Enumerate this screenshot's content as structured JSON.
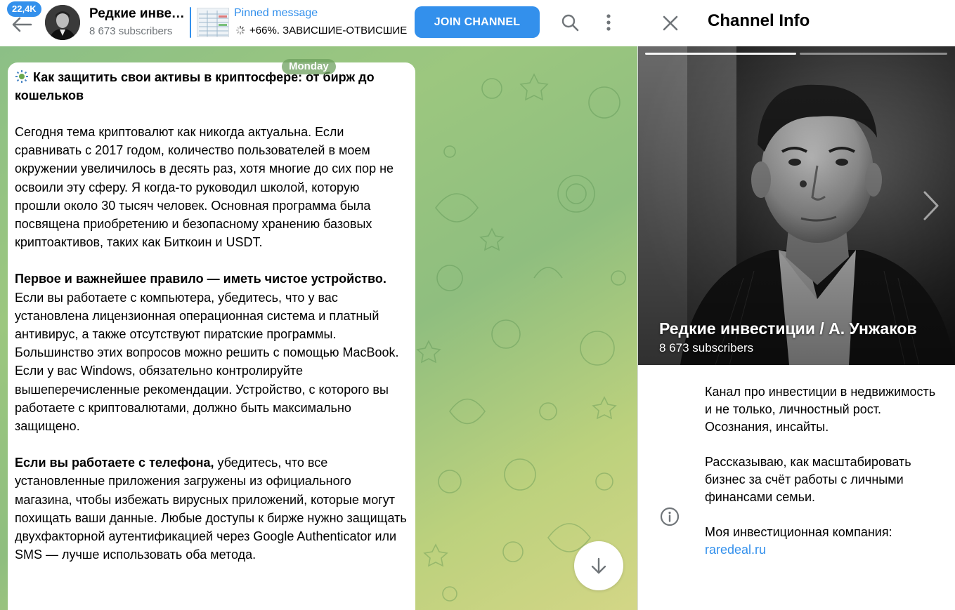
{
  "header": {
    "unread_badge": "22,4K",
    "channel_title": "Редкие инвестиции / А. Унжаков",
    "channel_subtitle": "8 673 subscribers",
    "pinned_title": "Pinned message",
    "pinned_text": "+66%. ЗАВИСШИЕ-ОТВИСШИЕ",
    "join_label": "JOIN CHANNEL",
    "icons": [
      "back-arrow-icon",
      "search-icon",
      "more-vertical-icon"
    ]
  },
  "chat": {
    "date_label": "Monday",
    "message": {
      "title": "Как защитить свои активы в криптосфере: от бирж до кошельков",
      "p1": "Сегодня тема криптовалют как никогда актуальна. Если сравнивать с 2017 годом, количество пользователей в моем окружении увеличилось в десять раз, хотя многие до сих пор не освоили эту сферу. Я когда-то руководил школой, которую прошли около 30 тысяч человек. Основная программа была посвящена приобретению и безопасному хранению базовых криптоактивов, таких как Биткоин и USDT.",
      "p2_bold": "Первое и важнейшее правило — иметь чистое устройство.",
      "p2_rest": " Если вы работаете с компьютера, убедитесь, что у вас установлена лицензионная операционная система и платный антивирус, а также отсутствуют пиратские программы. Большинство этих вопросов можно решить с помощью MacBook. Если у вас Windows, обязательно контролируйте вышеперечисленные рекомендации. Устройство, с которого вы работаете с криптовалютами, должно быть максимально защищено.",
      "p3_bold": "Если вы работаете с телефона,",
      "p3_rest": " убедитесь, что все установленные приложения загружены из официального магазина, чтобы избежать вирусных приложений, которые могут похищать ваши данные. Любые доступы к бирже нужно защищать двухфакторной аутентификацией через Google Authenticator или SMS — лучше использовать оба метода."
    }
  },
  "info": {
    "title": "Channel Info",
    "channel_name": "Редкие инвестиции / А. Унжаков",
    "subscribers": "8 673 subscribers",
    "description_1": "Канал про инвестиции в недвижимость и не только, личностный рост. Осознания, инсайты.",
    "description_2": "Рассказываю, как масштабировать бизнес за счёт работы с личными финансами семьи.",
    "description_3": "Моя инвестиционная компания:",
    "link": "raredeal.ru"
  },
  "colors": {
    "accent": "#3390ec",
    "secondary_text": "#707579"
  }
}
